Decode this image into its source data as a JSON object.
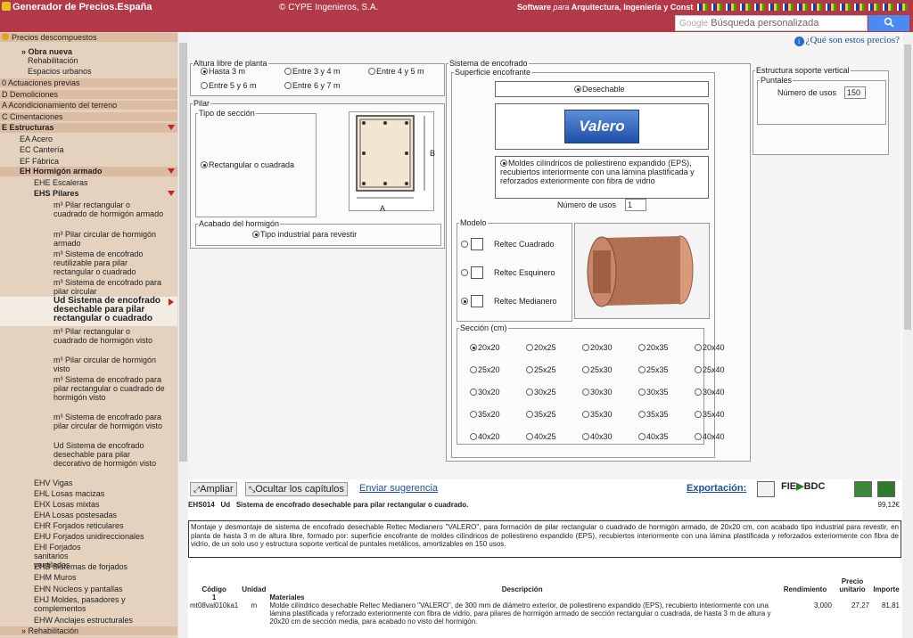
{
  "header": {
    "app_title": "Generador de Precios.España",
    "company": "© CYPE Ingenieros, S.A.",
    "software_prefix": "Software",
    "software_para": "para",
    "software_fields": "Arquitectura, Ingeniería y Construcción",
    "search_brand": "Google",
    "search_placeholder": "Búsqueda personalizada",
    "search_button_icon": "magnifier-icon"
  },
  "sidebar": {
    "root": "Precios descompuestos",
    "new_work": "» Obra nueva",
    "rehab": "Rehabilitación",
    "urban": "Espacios urbanos",
    "chapters": [
      "0 Actuaciones previas",
      "D Demoliciones",
      "A Acondicionamiento del terreno",
      "C Cimentaciones"
    ],
    "structures": "E Estructuras",
    "sub1": [
      "EA Acero",
      "EC Cantería",
      "EF Fábrica"
    ],
    "concrete": "EH Hormigón armado",
    "stairs": "EHE Escaleras",
    "pillars": "EHS Pilares",
    "pillar_items": [
      "m³ Pilar rectangular o cuadrado de hormigón armado",
      "m³ Pilar circular de hormigón armado",
      "m³ Sistema de encofrado reutilizable para pilar rectangular o cuadrado",
      "m³ Sistema de encofrado para pilar circular",
      "Ud Sistema de encofrado desechable para pilar rectangular o cuadrado",
      "m³ Pilar rectangular o cuadrado de hormigón visto",
      "m³ Pilar circular de hormigón visto",
      "m³ Sistema de encofrado para pilar rectangular o cuadrado de hormigón visto",
      "m³ Sistema de encofrado para pilar circular de hormigón visto",
      "Ud Sistema de encofrado desechable para pilar decorativo de hormigón visto"
    ],
    "rest": [
      "EHV Vigas",
      "EHL Losas macizas",
      "EHX Losas mixtas",
      "EHA Losas postesadas",
      "EHR Forjados reticulares",
      "EHU Forjados unidireccionales",
      "EHI Forjados sanitarios ventilados",
      "EHB Sistemas de forjados",
      "EHM Muros",
      "EHN Núcleos y pantallas",
      "EHJ Moldes, pasadores y complementos",
      "EHW Anclajes estructurales"
    ],
    "bottom_rehab": "» Rehabilitación"
  },
  "main": {
    "what_link": "¿Qué son estos precios?",
    "height_legend": "Altura libre de planta",
    "heights": [
      "Hasta 3 m",
      "Entre 3 y 4 m",
      "Entre 4 y 5 m",
      "Entre 5 y 6 m",
      "Entre 6 y 7 m"
    ],
    "pillar_legend": "Pilar",
    "section_type_legend": "Tipo de sección",
    "section_type": "Rectangular o cuadrada",
    "dim_a": "A",
    "dim_b": "B",
    "finish_legend": "Acabado del hormigón",
    "finish": "Tipo industrial para revestir",
    "formwork_legend": "Sistema de encofrado",
    "surface_legend": "Superficie encofrante",
    "disposable": "Desechable",
    "brand": "Valero",
    "mold_desc": "Moldes cilíndricos de poliestireno expandido (EPS), recubiertos interiormente con una lámina plastificada y reforzados exteriormente con fibra de vidrio",
    "uses_label": "Número de usos",
    "uses_value": "1",
    "model_legend": "Modelo",
    "models": [
      "Reltec Cuadrado",
      "Reltec Esquinero",
      "Reltec Medianero"
    ],
    "section_legend": "Sección (cm)",
    "sections": [
      "20x20",
      "20x25",
      "20x30",
      "20x35",
      "20x40",
      "25x20",
      "25x25",
      "25x30",
      "25x35",
      "25x40",
      "30x20",
      "30x25",
      "30x30",
      "30x35",
      "30x40",
      "35x20",
      "35x25",
      "35x30",
      "35x35",
      "35x40",
      "40x20",
      "40x25",
      "40x30",
      "40x35",
      "40x40"
    ],
    "support_legend": "Estructura soporte vertical",
    "props_legend": "Puntales",
    "props_uses_label": "Número de usos",
    "props_uses_value": "150"
  },
  "bottom": {
    "expand": "Ampliar",
    "hide": "Ocultar los capítulos",
    "suggest": "Enviar sugerencia",
    "export": "Exportación:",
    "fie": "FIE",
    "bdc": "BDC",
    "code": "EHS014",
    "unit": "Ud",
    "title": "Sistema de encofrado desechable para pilar rectangular o cuadrado.",
    "price": "99,12€",
    "description": "Montaje y desmontaje de sistema de encofrado desechable Reltec Medianero \"VALERO\", para formación de pilar rectangular o cuadrado de hormigón armado, de 20x20 cm, con acabado tipo industrial para revestir, en planta de hasta 3 m de altura libre, formado por: superficie encofrante de moldes cilíndricos de poliestireno expandido (EPS), recubiertos interiormente con una lámina plastificada y reforzados exteriormente con fibra de vidrio, de un solo uso y estructura soporte vertical de puntales metálicos, amortizables en 150 usos.",
    "col_code": "Código",
    "col_unit": "Unidad",
    "col_desc": "Descripción",
    "col_yield": "Rendimiento",
    "col_price": "Precio unitario",
    "col_amount": "Importe",
    "group_num": "1",
    "group_name": "Materiales",
    "row_code": "mt08val010ka1",
    "row_unit": "m",
    "row_desc": "Molde cilíndrico desechable Reltec Medianero \"VALERO\", de 300 mm de diámetro exterior, de poliestireno expandido (EPS), recubierto interiormente con una lámina plastificada y reforzado exteriormente con fibra de vidrio, para pilares de hormigón armado de sección rectangular o cuadrada, de hasta 3 m de altura y 20x20 cm de sección media, para acabado no visto del hormigón.",
    "row_yield": "3,000",
    "row_price": "27,27",
    "row_amount": "81,81"
  },
  "colors": {
    "brand_red": "#b23a48",
    "sidebar_bg": "#e4d2be",
    "link_blue": "#1a4fa0"
  }
}
